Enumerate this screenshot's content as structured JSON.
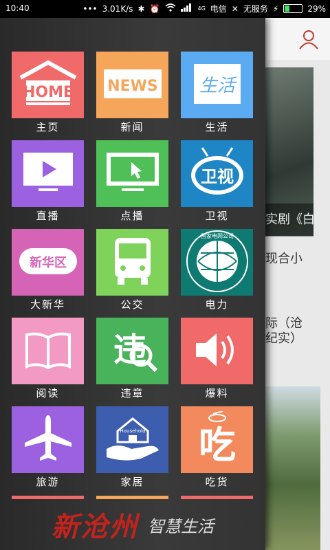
{
  "status_bar": {
    "time": "10:40",
    "speed": "3.01K/s",
    "network_label": "4G",
    "carrier1": "电信",
    "carrier2": "无服务",
    "battery": "29%",
    "battery_level": 0.29
  },
  "menu": {
    "tiles": [
      {
        "label": "主页",
        "icon": "home-icon",
        "icon_text": "HOME",
        "color": "#f06a6a"
      },
      {
        "label": "新闻",
        "icon": "news-icon",
        "icon_text": "NEWS",
        "color": "#f5a65b"
      },
      {
        "label": "生活",
        "icon": "life-icon",
        "icon_text": "生活",
        "color": "#5aabf1"
      },
      {
        "label": "直播",
        "icon": "live-tv-icon",
        "icon_text": "",
        "color": "#9b61e0"
      },
      {
        "label": "点播",
        "icon": "on-demand-icon",
        "icon_text": "",
        "color": "#4fbf57"
      },
      {
        "label": "卫视",
        "icon": "satellite-tv-icon",
        "icon_text": "卫视",
        "color": "#1f86c6"
      },
      {
        "label": "大新华",
        "icon": "xinhua-district-icon",
        "icon_text": "新华区",
        "color": "#d564b6"
      },
      {
        "label": "公交",
        "icon": "bus-icon",
        "icon_text": "",
        "color": "#7fd35b"
      },
      {
        "label": "电力",
        "icon": "state-grid-icon",
        "icon_text": "国家电网公司 STATE GRID CORPORATION OF CHINA",
        "color": "#0f7a72"
      },
      {
        "label": "阅读",
        "icon": "book-icon",
        "icon_text": "",
        "color": "#f29ac4"
      },
      {
        "label": "违章",
        "icon": "violation-search-icon",
        "icon_text": "违",
        "color": "#48b35a"
      },
      {
        "label": "爆料",
        "icon": "speaker-icon",
        "icon_text": "",
        "color": "#f06a6a"
      },
      {
        "label": "旅游",
        "icon": "airplane-icon",
        "icon_text": "",
        "color": "#9b61e0"
      },
      {
        "label": "家居",
        "icon": "household-icon",
        "icon_text": "Household",
        "color": "#3d5dae"
      },
      {
        "label": "吃货",
        "icon": "food-icon",
        "icon_text": "吃",
        "color": "#f38a5d"
      }
    ],
    "peek_colors": [
      "#f06a6a",
      "#f5a65b",
      "#f06a6a"
    ]
  },
  "footer": {
    "brand": "新沧州",
    "slogan": "智慧生活"
  },
  "background": {
    "caption1": "实剧《白",
    "text1": "现合小",
    "text2": "际（沧",
    "text3": "纪实）"
  }
}
